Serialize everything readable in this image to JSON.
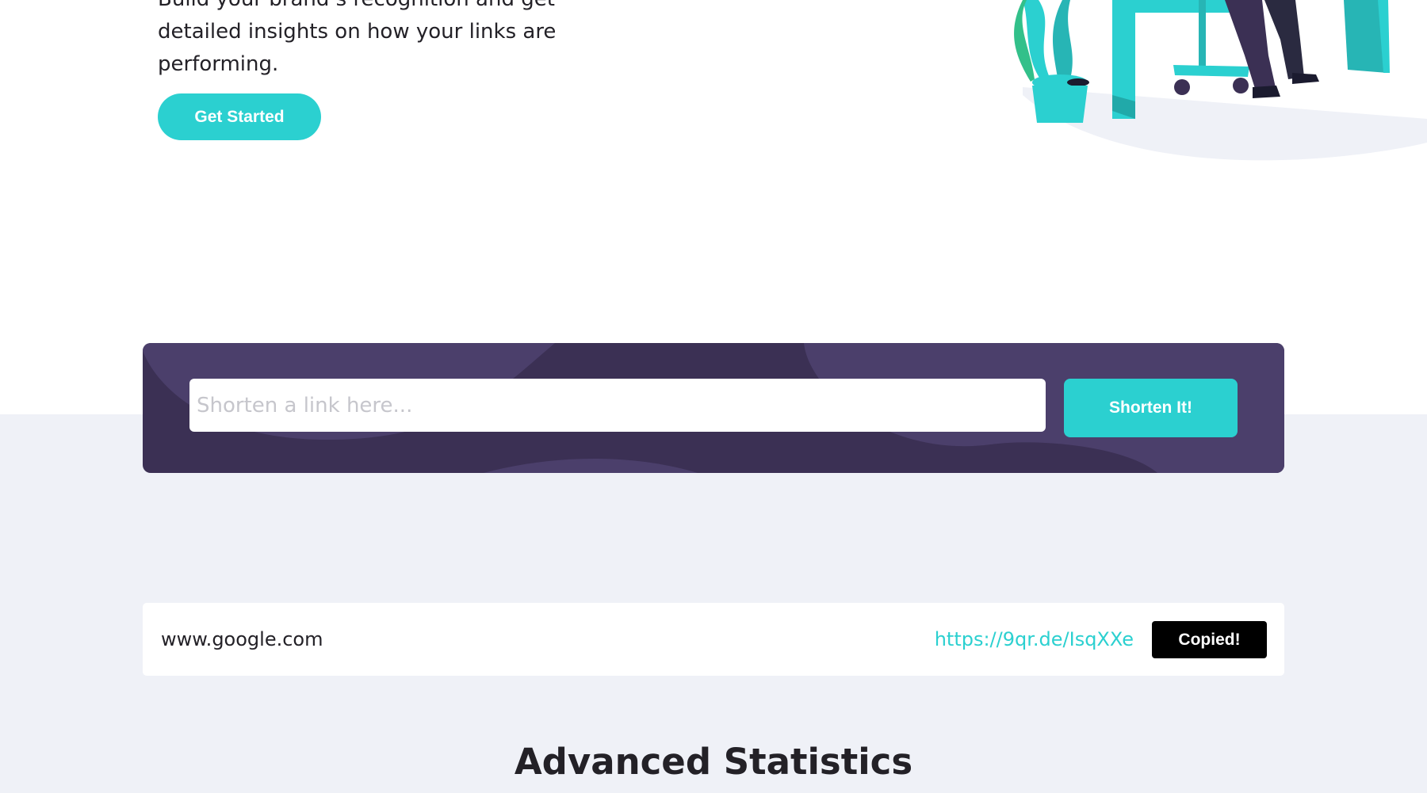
{
  "hero": {
    "description_lines": [
      "Build your brand’s recognition and get",
      "detailed insights on how your links are",
      "performing."
    ],
    "get_started_label": "Get Started"
  },
  "shortener": {
    "placeholder": "Shorten a link here...",
    "input_value": "",
    "button_label": "Shorten It!"
  },
  "results": [
    {
      "original": "www.google.com",
      "short": "https://9qr.de/IsqXXe",
      "copy_label": "Copied!"
    }
  ],
  "statistics": {
    "title": "Advanced Statistics"
  },
  "colors": {
    "primary_cyan": "#2bd0d0",
    "dark_violet": "#3b3054",
    "light_gray_bg": "#eff1f7",
    "copied_button": "#000000"
  }
}
